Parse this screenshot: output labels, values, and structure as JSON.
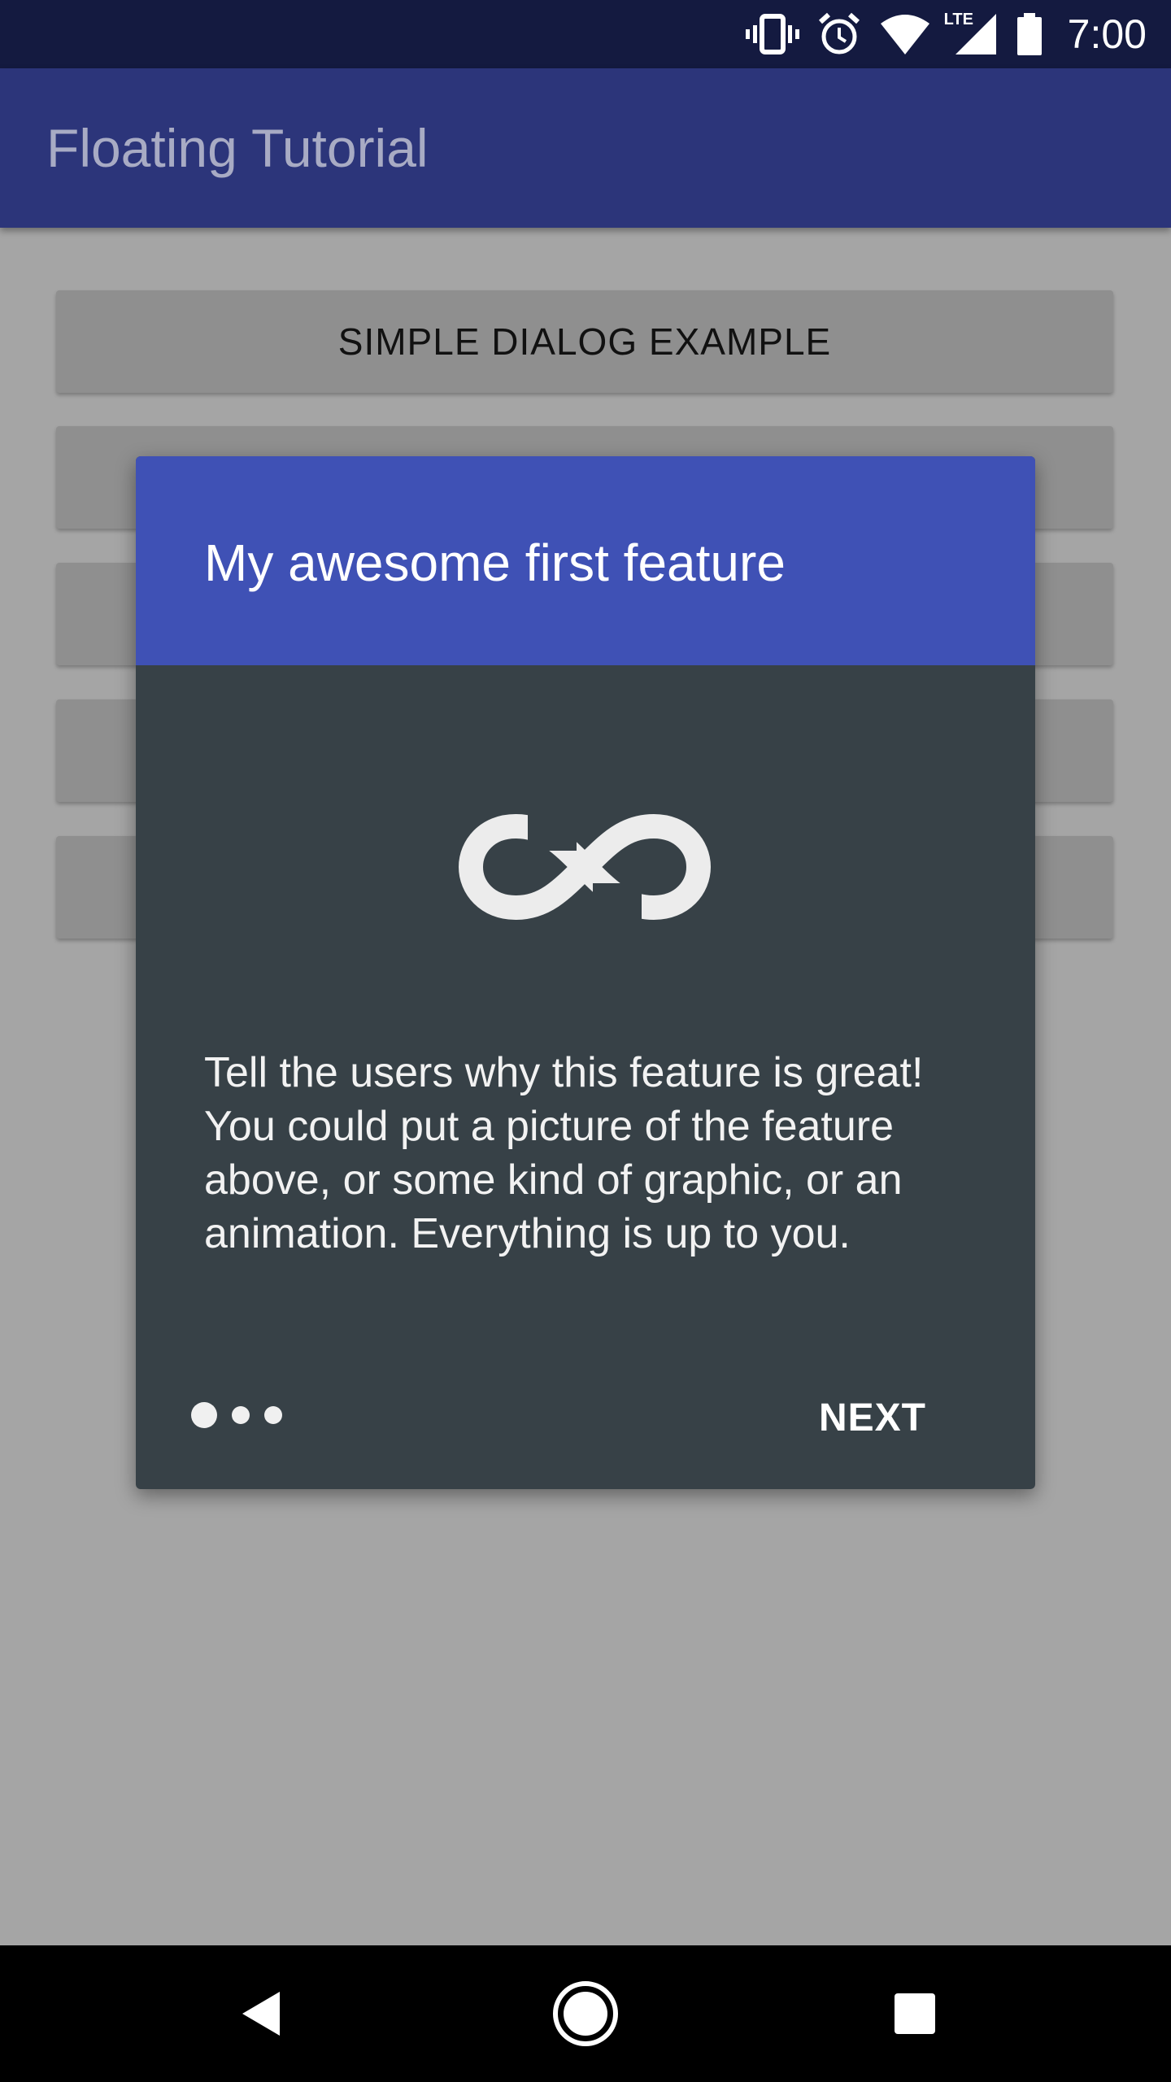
{
  "status_bar": {
    "time": "7:00",
    "icons": [
      "vibrate-icon",
      "alarm-icon",
      "wifi-icon",
      "lte-signal-icon",
      "battery-icon"
    ],
    "lte_label": "LTE"
  },
  "app_bar": {
    "title": "Floating Tutorial"
  },
  "buttons": [
    {
      "label": "SIMPLE DIALOG EXAMPLE"
    },
    {
      "label": ""
    },
    {
      "label": ""
    },
    {
      "label": ""
    },
    {
      "label": ""
    }
  ],
  "dialog": {
    "title": "My awesome first feature",
    "icon": "infinity-icon",
    "body": "Tell the users why this feature is great! You could put a picture of the feature above, or some kind of graphic, or an animation. Everything is up to you.",
    "page_indicator": {
      "current": 1,
      "total": 3
    },
    "next_label": "NEXT"
  },
  "nav_bar": {
    "icons": [
      "back-icon",
      "home-icon",
      "recents-icon"
    ]
  },
  "colors": {
    "status_bar": "#141a40",
    "app_bar": "#2c357a",
    "dialog_header": "#3f51b5",
    "dialog_body": "#374147",
    "scrim": "#a5a5a5"
  }
}
